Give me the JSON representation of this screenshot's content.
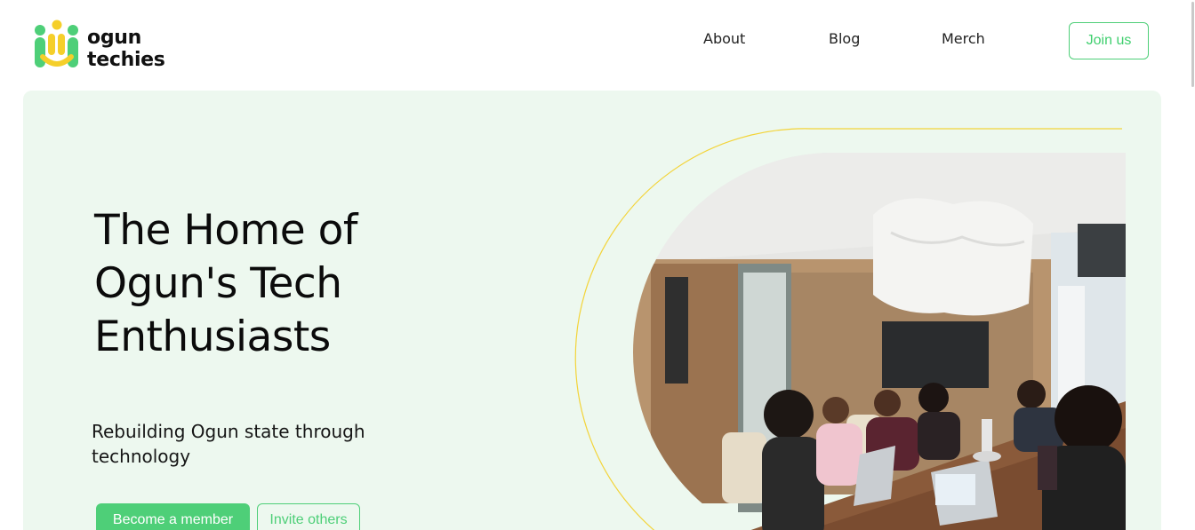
{
  "brand": {
    "name_line1": "ogun",
    "name_line2": "techies",
    "logo_colors": {
      "green": "#4ecf78",
      "yellow": "#f5cf2a"
    }
  },
  "nav": {
    "items": [
      {
        "label": "About"
      },
      {
        "label": "Blog"
      },
      {
        "label": "Merch"
      }
    ],
    "cta_label": "Join us"
  },
  "hero": {
    "title_lines": [
      "The Home of",
      "Ogun's Tech",
      "Enthusiasts"
    ],
    "subtitle": "Rebuilding Ogun state through technology",
    "primary_cta": "Become a member",
    "secondary_cta": "Invite others",
    "image_subject": "team-meeting-photo"
  },
  "colors": {
    "accent": "#4ecf78",
    "hero_background": "#edf8ef",
    "arc_line": "#f3d43a"
  }
}
